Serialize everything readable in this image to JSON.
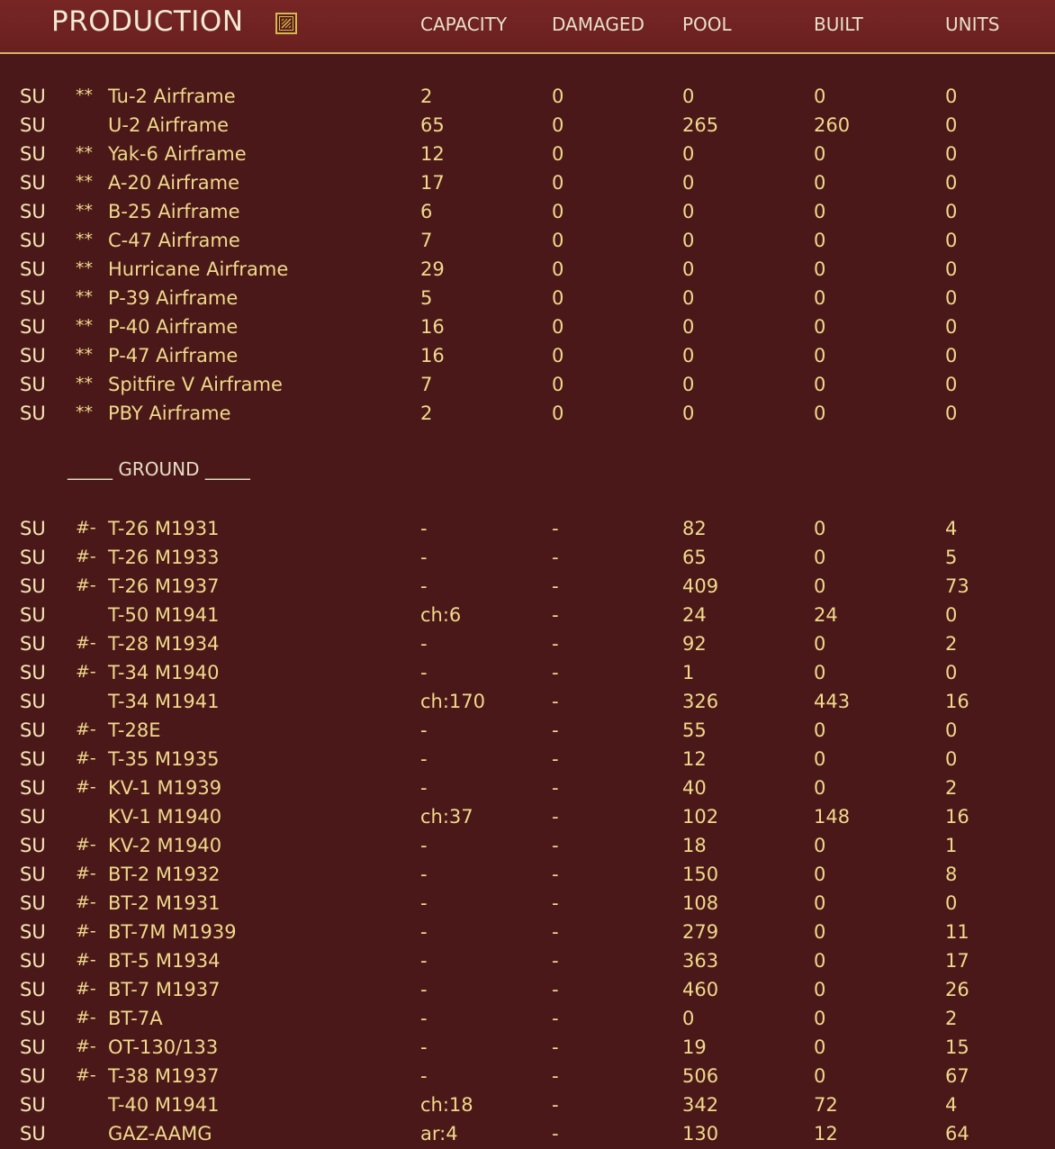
{
  "header": {
    "title": "PRODUCTION",
    "report_icon": "chart-report-icon",
    "columns": {
      "capacity": "CAPACITY",
      "damaged": "DAMAGED",
      "pool": "POOL",
      "built": "BUILT",
      "units": "UNITS"
    }
  },
  "colors": {
    "background": "#4a1818",
    "header_background": "#6f2222",
    "header_rule": "#d2b46a",
    "text_yellow": "#f0d98c",
    "text_cream": "#f4e6b4"
  },
  "air_rows": [
    {
      "nat": "SU",
      "flag": "**",
      "name": "Tu-2 Airframe",
      "capacity": "2",
      "damaged": "0",
      "pool": "0",
      "built": "0",
      "units": "0"
    },
    {
      "nat": "SU",
      "flag": "",
      "name": "U-2 Airframe",
      "capacity": "65",
      "damaged": "0",
      "pool": "265",
      "built": "260",
      "units": "0"
    },
    {
      "nat": "SU",
      "flag": "**",
      "name": "Yak-6 Airframe",
      "capacity": "12",
      "damaged": "0",
      "pool": "0",
      "built": "0",
      "units": "0"
    },
    {
      "nat": "SU",
      "flag": "**",
      "name": "A-20 Airframe",
      "capacity": "17",
      "damaged": "0",
      "pool": "0",
      "built": "0",
      "units": "0"
    },
    {
      "nat": "SU",
      "flag": "**",
      "name": "B-25 Airframe",
      "capacity": "6",
      "damaged": "0",
      "pool": "0",
      "built": "0",
      "units": "0"
    },
    {
      "nat": "SU",
      "flag": "**",
      "name": "C-47 Airframe",
      "capacity": "7",
      "damaged": "0",
      "pool": "0",
      "built": "0",
      "units": "0"
    },
    {
      "nat": "SU",
      "flag": "**",
      "name": "Hurricane Airframe",
      "capacity": "29",
      "damaged": "0",
      "pool": "0",
      "built": "0",
      "units": "0"
    },
    {
      "nat": "SU",
      "flag": "**",
      "name": "P-39 Airframe",
      "capacity": "5",
      "damaged": "0",
      "pool": "0",
      "built": "0",
      "units": "0"
    },
    {
      "nat": "SU",
      "flag": "**",
      "name": "P-40 Airframe",
      "capacity": "16",
      "damaged": "0",
      "pool": "0",
      "built": "0",
      "units": "0"
    },
    {
      "nat": "SU",
      "flag": "**",
      "name": "P-47 Airframe",
      "capacity": "16",
      "damaged": "0",
      "pool": "0",
      "built": "0",
      "units": "0"
    },
    {
      "nat": "SU",
      "flag": "**",
      "name": "Spitfire V Airframe",
      "capacity": "7",
      "damaged": "0",
      "pool": "0",
      "built": "0",
      "units": "0"
    },
    {
      "nat": "SU",
      "flag": "**",
      "name": "PBY Airframe",
      "capacity": "2",
      "damaged": "0",
      "pool": "0",
      "built": "0",
      "units": "0"
    }
  ],
  "ground_label": "_____ GROUND _____",
  "ground_rows": [
    {
      "nat": "SU",
      "flag": "#-",
      "name": "T-26 M1931",
      "capacity": "-",
      "damaged": "-",
      "pool": "82",
      "built": "0",
      "units": "4"
    },
    {
      "nat": "SU",
      "flag": "#-",
      "name": "T-26 M1933",
      "capacity": "-",
      "damaged": "-",
      "pool": "65",
      "built": "0",
      "units": "5"
    },
    {
      "nat": "SU",
      "flag": "#-",
      "name": "T-26 M1937",
      "capacity": "-",
      "damaged": "-",
      "pool": "409",
      "built": "0",
      "units": "73"
    },
    {
      "nat": "SU",
      "flag": "",
      "name": "T-50 M1941",
      "capacity": "ch:6",
      "damaged": "-",
      "pool": "24",
      "built": "24",
      "units": "0"
    },
    {
      "nat": "SU",
      "flag": "#-",
      "name": "T-28 M1934",
      "capacity": "-",
      "damaged": "-",
      "pool": "92",
      "built": "0",
      "units": "2"
    },
    {
      "nat": "SU",
      "flag": "#-",
      "name": "T-34 M1940",
      "capacity": "-",
      "damaged": "-",
      "pool": "1",
      "built": "0",
      "units": "0"
    },
    {
      "nat": "SU",
      "flag": "",
      "name": "T-34 M1941",
      "capacity": "ch:170",
      "damaged": "-",
      "pool": "326",
      "built": "443",
      "units": "16"
    },
    {
      "nat": "SU",
      "flag": "#-",
      "name": "T-28E",
      "capacity": "-",
      "damaged": "-",
      "pool": "55",
      "built": "0",
      "units": "0"
    },
    {
      "nat": "SU",
      "flag": "#-",
      "name": "T-35 M1935",
      "capacity": "-",
      "damaged": "-",
      "pool": "12",
      "built": "0",
      "units": "0"
    },
    {
      "nat": "SU",
      "flag": "#-",
      "name": "KV-1 M1939",
      "capacity": "-",
      "damaged": "-",
      "pool": "40",
      "built": "0",
      "units": "2"
    },
    {
      "nat": "SU",
      "flag": "",
      "name": "KV-1 M1940",
      "capacity": "ch:37",
      "damaged": "-",
      "pool": "102",
      "built": "148",
      "units": "16"
    },
    {
      "nat": "SU",
      "flag": "#-",
      "name": "KV-2 M1940",
      "capacity": "-",
      "damaged": "-",
      "pool": "18",
      "built": "0",
      "units": "1"
    },
    {
      "nat": "SU",
      "flag": "#-",
      "name": "BT-2 M1932",
      "capacity": "-",
      "damaged": "-",
      "pool": "150",
      "built": "0",
      "units": "8"
    },
    {
      "nat": "SU",
      "flag": "#-",
      "name": "BT-2 M1931",
      "capacity": "-",
      "damaged": "-",
      "pool": "108",
      "built": "0",
      "units": "0"
    },
    {
      "nat": "SU",
      "flag": "#-",
      "name": "BT-7M M1939",
      "capacity": "-",
      "damaged": "-",
      "pool": "279",
      "built": "0",
      "units": "11"
    },
    {
      "nat": "SU",
      "flag": "#-",
      "name": "BT-5 M1934",
      "capacity": "-",
      "damaged": "-",
      "pool": "363",
      "built": "0",
      "units": "17"
    },
    {
      "nat": "SU",
      "flag": "#-",
      "name": "BT-7 M1937",
      "capacity": "-",
      "damaged": "-",
      "pool": "460",
      "built": "0",
      "units": "26"
    },
    {
      "nat": "SU",
      "flag": "#-",
      "name": "BT-7A",
      "capacity": "-",
      "damaged": "-",
      "pool": "0",
      "built": "0",
      "units": "2"
    },
    {
      "nat": "SU",
      "flag": "#-",
      "name": "OT-130/133",
      "capacity": "-",
      "damaged": "-",
      "pool": "19",
      "built": "0",
      "units": "15"
    },
    {
      "nat": "SU",
      "flag": "#-",
      "name": "T-38 M1937",
      "capacity": "-",
      "damaged": "-",
      "pool": "506",
      "built": "0",
      "units": "67"
    },
    {
      "nat": "SU",
      "flag": "",
      "name": "T-40 M1941",
      "capacity": "ch:18",
      "damaged": "-",
      "pool": "342",
      "built": "72",
      "units": "4"
    },
    {
      "nat": "SU",
      "flag": "",
      "name": "GAZ-AAMG",
      "capacity": "ar:4",
      "damaged": "-",
      "pool": "130",
      "built": "12",
      "units": "64"
    }
  ]
}
